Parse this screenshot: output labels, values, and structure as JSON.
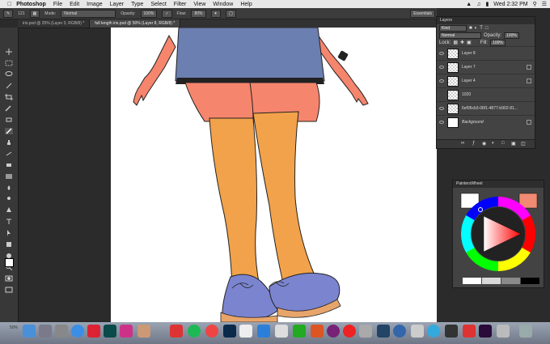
{
  "menubar": {
    "app": "Photoshop",
    "items": [
      "File",
      "Edit",
      "Image",
      "Layer",
      "Type",
      "Select",
      "Filter",
      "View",
      "Window",
      "Help"
    ],
    "clock": "Wed 2:32 PM"
  },
  "options": {
    "brush_size": "121",
    "mode_label": "Mode:",
    "mode_value": "Normal",
    "opacity_label": "Opacity:",
    "opacity_value": "100%",
    "flow_label": "Flow:",
    "flow_value": "80%",
    "workspace": "Essentials"
  },
  "tabs": [
    {
      "label": "iris.psd @ 25% (Layer 3, RGB/8) *"
    },
    {
      "label": "full length iris.psd @ 50% (Layer 8, RGB/8) *"
    }
  ],
  "layers_panel": {
    "title": "Layers",
    "kind_value": "Kind",
    "blend_value": "Normal",
    "opacity_label": "Opacity:",
    "opacity_value": "100%",
    "lock_label": "Lock:",
    "fill_label": "Fill:",
    "fill_value": "100%",
    "layers": [
      {
        "name": "Layer 8",
        "thumb": "checker"
      },
      {
        "name": "Layer 7",
        "thumb": "checker"
      },
      {
        "name": "Layer 4",
        "thumb": "checker"
      },
      {
        "name": "1020",
        "thumb": "checker"
      },
      {
        "name": "6ef95cb3-06f1-4877-b902-81...",
        "thumb": "checker"
      },
      {
        "name": "Background",
        "thumb": "white"
      }
    ]
  },
  "wheel_panel": {
    "title": "PaintersWheel",
    "swatches": [
      "#ffffff",
      "#d9d9d9",
      "#8a8a8a",
      "#303030",
      "#000000"
    ],
    "fg_color": "#ffffff",
    "bg_color": "#f08a72"
  },
  "status": {
    "zoom": "50%"
  },
  "colors": {
    "skin": "#f5856c",
    "skirt": "#6b7fb0",
    "stockings": "#f2a24a",
    "shoes": "#7b84cf"
  }
}
